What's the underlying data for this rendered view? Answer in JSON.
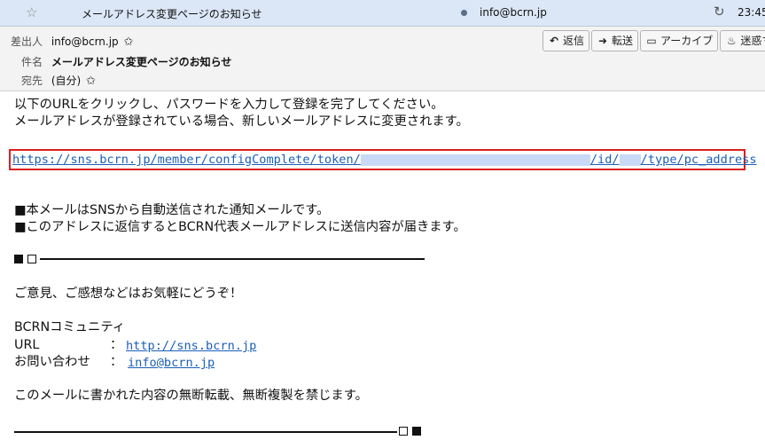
{
  "message_list": {
    "subject": "メールアドレス変更ページのお知らせ",
    "from": "info@bcrn.jp",
    "time": "23:45",
    "star_icon": "star-outline-icon",
    "thread_icon": "thread-icon"
  },
  "header": {
    "from_label": "差出人",
    "from_value": "info@bcrn.jp",
    "subject_label": "件名",
    "subject_value": "メールアドレス変更ページのお知らせ",
    "to_label": "宛先",
    "to_value": "(自分)"
  },
  "toolbar": {
    "reply_label": "返信",
    "forward_label": "転送",
    "archive_label": "アーカイブ",
    "junk_label": "迷惑マー"
  },
  "body": {
    "line1": "以下のURLをクリックし、パスワードを入力して登録を完了してください。",
    "line2": "メールアドレスが登録されている場合、新しいメールアドレスに変更されます。",
    "url_part1": "https://sns.bcrn.jp/member/configComplete/token/",
    "url_part2": "/id/",
    "url_part3": "/type/pc_address",
    "notice1": "■本メールはSNSから自動送信された通知メールです。",
    "notice2": "■このアドレスに返信するとBCRN代表メールアドレスに送信内容が届きます。",
    "feedback": "ご意見、ご感想などはお気軽にどうぞ！",
    "community": "BCRNコミュニティ",
    "url_label": "URL",
    "url_colon": "：",
    "url_value": "http://sns.bcrn.jp",
    "contact_label": "お問い合わせ",
    "contact_colon": "：",
    "contact_value": "info@bcrn.jp",
    "copyright": "このメールに書かれた内容の無断転載、無断複製を禁じます。"
  }
}
